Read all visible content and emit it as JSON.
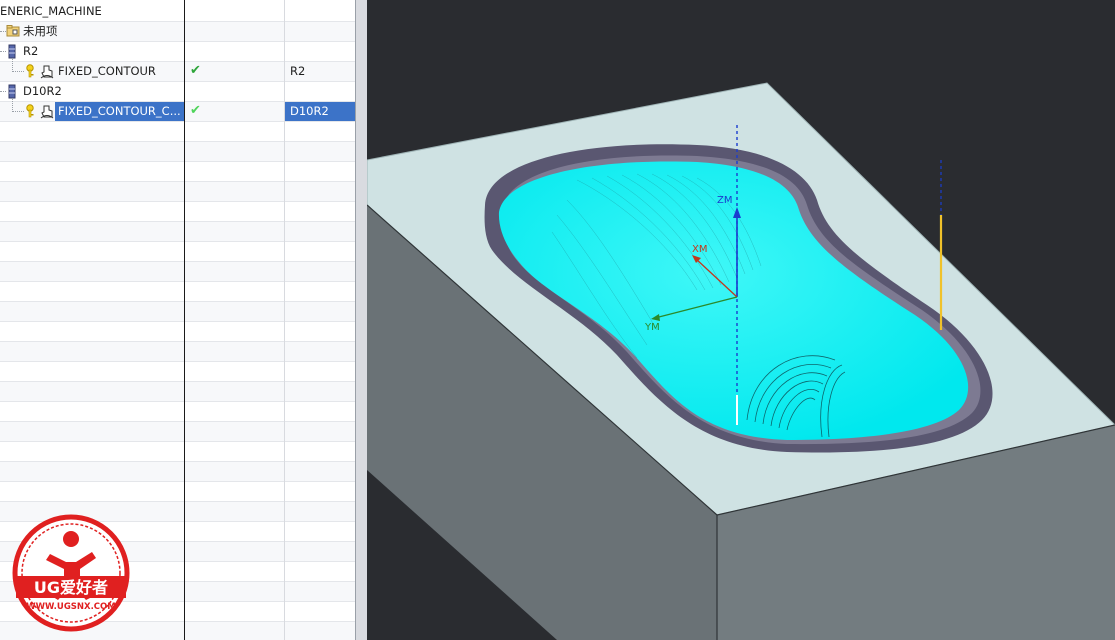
{
  "navigator": {
    "root_label": "ENERIC_MACHINE",
    "unused_label": "未用项",
    "rows": [
      {
        "name": "R2",
        "type": "tool",
        "check": "",
        "tool": ""
      },
      {
        "name": "FIXED_CONTOUR",
        "type": "operation",
        "check": "✔",
        "tool": "R2"
      },
      {
        "name": "D10R2",
        "type": "tool",
        "check": "",
        "tool": ""
      },
      {
        "name": "FIXED_CONTOUR_C...",
        "type": "operation",
        "check": "✔",
        "tool": "D10R2",
        "selected": true
      }
    ]
  },
  "viewport": {
    "axis_labels": {
      "z": "ZM",
      "x": "XM",
      "y": "YM"
    },
    "colors": {
      "background": "#2a2c30",
      "toolpath": "#00f0f0",
      "block_top": "#cde0e2",
      "block_side": "#6e777b",
      "cavity_wall": "#5b5874"
    }
  },
  "watermark": {
    "brand": "UG爱好者",
    "url": "WWW.UGSNX.COM"
  }
}
